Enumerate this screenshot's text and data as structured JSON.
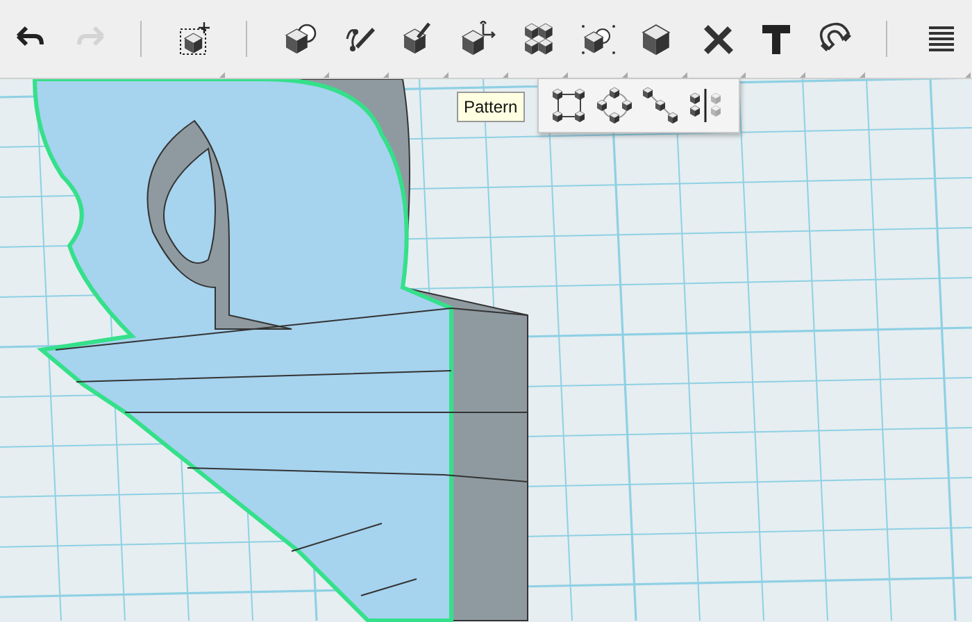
{
  "toolbar": {
    "buttons": [
      {
        "kind": "undo",
        "disabled": false
      },
      {
        "kind": "redo",
        "disabled": true
      },
      {
        "kind": "separator"
      },
      {
        "kind": "select",
        "disabled": false
      },
      {
        "kind": "separator"
      },
      {
        "kind": "combine",
        "disabled": false
      },
      {
        "kind": "sketch",
        "disabled": false
      },
      {
        "kind": "paint",
        "disabled": false
      },
      {
        "kind": "move",
        "disabled": false
      },
      {
        "kind": "pattern",
        "disabled": false
      },
      {
        "kind": "group",
        "disabled": false
      },
      {
        "kind": "solid",
        "disabled": false
      },
      {
        "kind": "measure",
        "disabled": false
      },
      {
        "kind": "text",
        "disabled": false
      },
      {
        "kind": "snap",
        "disabled": false
      },
      {
        "kind": "separator"
      },
      {
        "kind": "layers",
        "disabled": false
      }
    ]
  },
  "tooltip": {
    "text": "Pattern"
  },
  "pattern_menu": {
    "items": [
      {
        "kind": "rectangular"
      },
      {
        "kind": "circular"
      },
      {
        "kind": "path"
      },
      {
        "kind": "mirror"
      }
    ]
  }
}
